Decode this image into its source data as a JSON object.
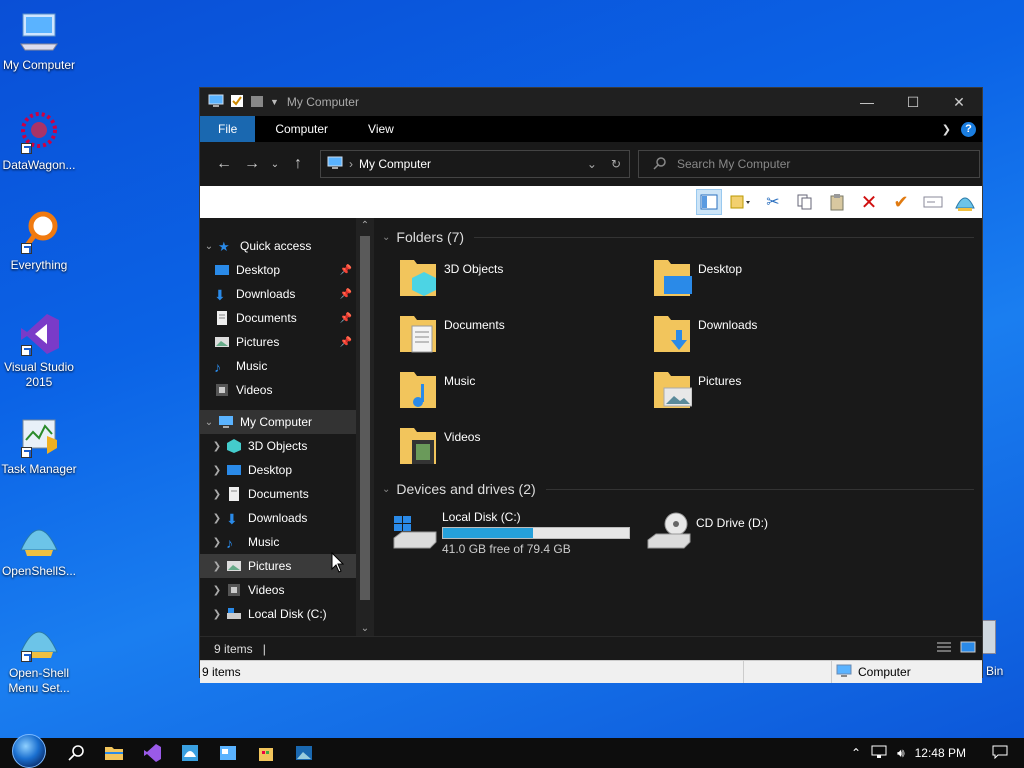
{
  "desktop": {
    "icons": [
      {
        "label": "My Computer"
      },
      {
        "label": "DataWagon..."
      },
      {
        "label": "Everything"
      },
      {
        "label": "Visual Studio 2015"
      },
      {
        "label": "Task Manager"
      },
      {
        "label": "OpenShellS..."
      },
      {
        "label": "Open-Shell Menu Set..."
      }
    ],
    "recycle_bin_partial": "Bin"
  },
  "window": {
    "title": "My Computer",
    "tabs": {
      "file": "File",
      "computer": "Computer",
      "view": "View"
    },
    "help": "?",
    "address": {
      "location": "My Computer"
    },
    "search": {
      "placeholder": "Search My Computer"
    },
    "nav": {
      "quick_access": "Quick access",
      "quick_items": [
        "Desktop",
        "Downloads",
        "Documents",
        "Pictures",
        "Music",
        "Videos"
      ],
      "my_computer": "My Computer",
      "computer_items": [
        "3D Objects",
        "Desktop",
        "Documents",
        "Downloads",
        "Music",
        "Pictures",
        "Videos",
        "Local Disk (C:)"
      ]
    },
    "folders_header": "Folders (7)",
    "folders": [
      "3D Objects",
      "Desktop",
      "Documents",
      "Downloads",
      "Music",
      "Pictures",
      "Videos"
    ],
    "drives_header": "Devices and drives (2)",
    "drives": [
      {
        "name": "Local Disk (C:)",
        "free": "41.0 GB free of 79.4 GB",
        "used_fraction": 0.484
      },
      {
        "name": "CD Drive (D:)"
      }
    ],
    "status": {
      "items": "9 items",
      "classic_items": "9 items",
      "zone": "Computer"
    }
  },
  "taskbar": {
    "time": "12:48 PM"
  },
  "colors": {
    "accent": "#1a68b0",
    "bar_fill": "#26a0da",
    "folder": "#f2c55c"
  }
}
